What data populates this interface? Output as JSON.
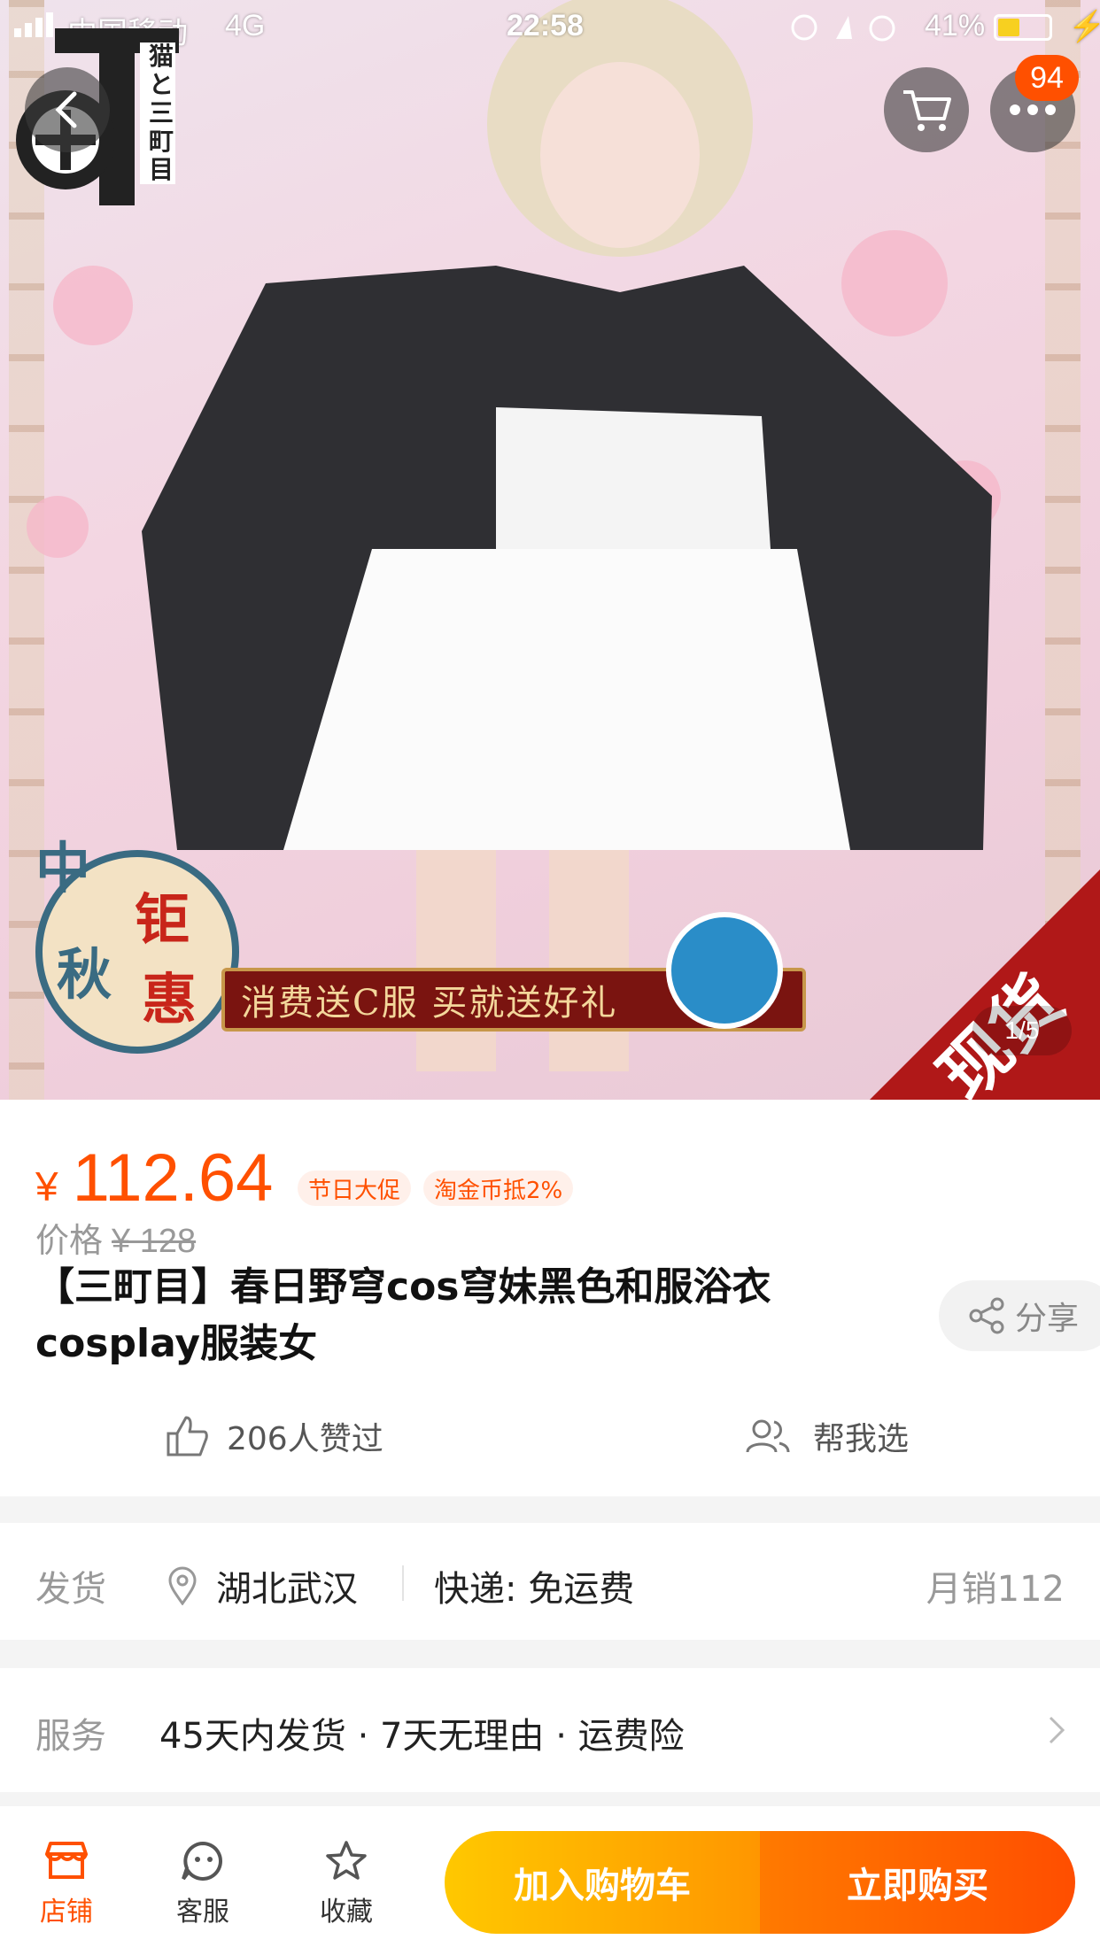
{
  "status_bar": {
    "carrier": "中国移动",
    "network": "4G",
    "time": "22:58",
    "battery_percent": "41%",
    "battery_level": 0.41
  },
  "header": {
    "cart_badge": "94",
    "back_icon": "chevron-left-icon",
    "cart_icon": "cart-icon",
    "more_icon": "more-icon"
  },
  "hero": {
    "brand_text": "猫と三町目",
    "promo_seal": [
      "中",
      "钜",
      "秋",
      "惠"
    ],
    "promo_banner": "消费送C服 买就送好礼",
    "stock_label": "现货",
    "page_indicator": "1/5"
  },
  "product": {
    "currency": "¥",
    "price": "112.64",
    "tags": [
      "节日大促",
      "淘金币抵2%"
    ],
    "original_price_label": "价格",
    "original_price": "¥ 128",
    "title": "【三町目】春日野穹cos穹妹黑色和服浴衣cosplay服装女",
    "share_label": "分享",
    "likes": "206人赞过",
    "help_choose": "帮我选"
  },
  "delivery": {
    "label": "发货",
    "location": "湖北武汉",
    "shipping": "快递: 免运费",
    "monthly_sales": "月销112"
  },
  "service": {
    "label": "服务",
    "text": "45天内发货 · 7天无理由 · 运费险"
  },
  "bottom_bar": {
    "shop": "店铺",
    "customer_service": "客服",
    "favorite": "收藏",
    "add_to_cart": "加入购物车",
    "buy_now": "立即购买"
  },
  "colors": {
    "accent": "#ff5000",
    "cart_gradient": [
      "#ffc800",
      "#ff9600"
    ],
    "buy_gradient": [
      "#ff7a00",
      "#ff4e00"
    ]
  }
}
